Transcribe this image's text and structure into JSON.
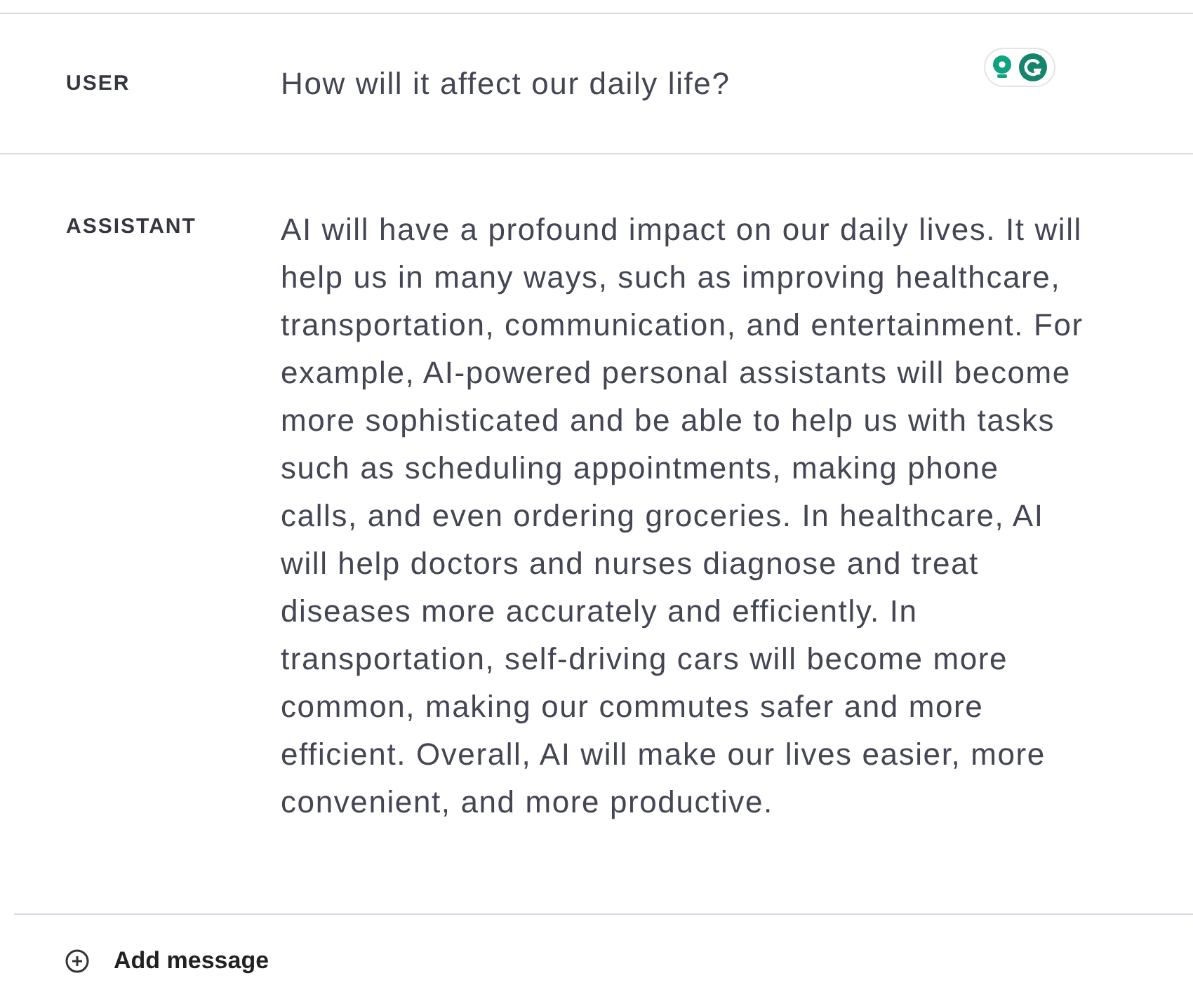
{
  "messages": [
    {
      "role": "USER",
      "text": "How will it affect our daily life?"
    },
    {
      "role": "ASSISTANT",
      "text": "AI will have a profound impact on our daily lives. It will help us in many ways, such as improving healthcare, transportation, communication, and entertainment. For example, AI-powered personal assistants will become more sophisticated and be able to help us with tasks such as scheduling appointments, making phone calls, and even ordering groceries. In healthcare, AI will help doctors and nurses diagnose and treat diseases more accurately and efficiently. In transportation, self-driving cars will become more common, making our commutes safer and more efficient. Overall, AI will make our lives easier, more convenient, and more productive."
    }
  ],
  "add_message": {
    "label": "Add message"
  }
}
